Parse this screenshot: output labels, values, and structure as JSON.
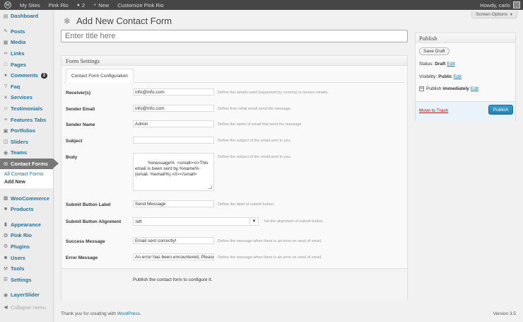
{
  "adminbar": {
    "my_sites": "My Sites",
    "site_name": "Pink Rio",
    "comments_count": "2",
    "new_label": "New",
    "customize": "Customize Pink Rio",
    "howdy": "Howdy, carlo"
  },
  "sidebar": {
    "items": [
      {
        "label": "Dashboard",
        "icon": "dashboard-icon"
      },
      {
        "label": "Posts",
        "icon": "posts-icon"
      },
      {
        "label": "Media",
        "icon": "media-icon"
      },
      {
        "label": "Links",
        "icon": "links-icon"
      },
      {
        "label": "Pages",
        "icon": "pages-icon"
      },
      {
        "label": "Comments",
        "icon": "comments-icon",
        "badge": "2"
      },
      {
        "label": "Faq",
        "icon": "faq-icon"
      },
      {
        "label": "Services",
        "icon": "services-icon"
      },
      {
        "label": "Testimonials",
        "icon": "testimonials-icon"
      },
      {
        "label": "Features Tabs",
        "icon": "features-tabs-icon"
      },
      {
        "label": "Portfolios",
        "icon": "portfolios-icon"
      },
      {
        "label": "Sliders",
        "icon": "sliders-icon"
      },
      {
        "label": "Teams",
        "icon": "teams-icon"
      },
      {
        "label": "Contact Forms",
        "icon": "contact-forms-icon"
      },
      {
        "label": "WooCommerce",
        "icon": "woocommerce-icon"
      },
      {
        "label": "Products",
        "icon": "products-icon"
      },
      {
        "label": "Appearance",
        "icon": "appearance-icon"
      },
      {
        "label": "Pink Rio",
        "icon": "pink-rio-icon"
      },
      {
        "label": "Plugins",
        "icon": "plugins-icon"
      },
      {
        "label": "Users",
        "icon": "users-icon"
      },
      {
        "label": "Tools",
        "icon": "tools-icon"
      },
      {
        "label": "Settings",
        "icon": "settings-icon"
      },
      {
        "label": "LayerSlider",
        "icon": "layerslider-icon"
      }
    ],
    "submenu": {
      "all": "All Contact Forms",
      "add_new": "Add New"
    },
    "collapse": "Collapse menu"
  },
  "main": {
    "screen_options": "Screen Options",
    "page_title": "Add New Contact Form",
    "title_placeholder": "Enter title here",
    "form_settings": {
      "title": "Form Settings",
      "tab": "Contact Form Configuration",
      "rows": {
        "receivers": {
          "label": "Receiver(s)",
          "value": "info@info.com",
          "hint": "Define the emails used (separeted by comma) to receive emails."
        },
        "sender_email": {
          "label": "Sender Email",
          "value": "info@info.com",
          "hint": "Define from what email send the message."
        },
        "sender_name": {
          "label": "Sender Name",
          "value": "Admin",
          "hint": "Define the name of email that send the message."
        },
        "subject": {
          "label": "Subject",
          "value": "",
          "hint": "Define the subject of the email sent to you."
        },
        "body": {
          "label": "Body",
          "value": "%message%  <small><i>This email is been sent by %name% (email. %email%).</i></small>",
          "hint": "Define the subject of the email sent to you."
        },
        "submit_label": {
          "label": "Submit Button Label",
          "value": "Send Message",
          "hint": "Define the label of submit button."
        },
        "submit_alignment": {
          "label": "Submit Button Alignment",
          "value": "left",
          "hint": "Set the alignment of submit button."
        },
        "success": {
          "label": "Success Message",
          "value": "Email sent correctly!",
          "hint": "Define the message when there is an error on send of email."
        },
        "error": {
          "label": "Error Message",
          "value": "An error has been encountered. Please try again.",
          "hint": "Define the message when there is an error on send of email."
        }
      },
      "footer_note": "Publish the contact form to configure it."
    },
    "publish": {
      "title": "Publish",
      "save_draft": "Save Draft",
      "status_label": "Status:",
      "status_value": "Draft",
      "visibility_label": "Visibility:",
      "visibility_value": "Public",
      "publish_label": "Publish",
      "publish_value": "immediately",
      "edit": "Edit",
      "trash": "Move to Trash",
      "publish_button": "Publish"
    }
  },
  "footer": {
    "thanks": "Thank you for creating with",
    "wordpress": "WordPress",
    "period": ".",
    "version": "Version 3.5"
  }
}
